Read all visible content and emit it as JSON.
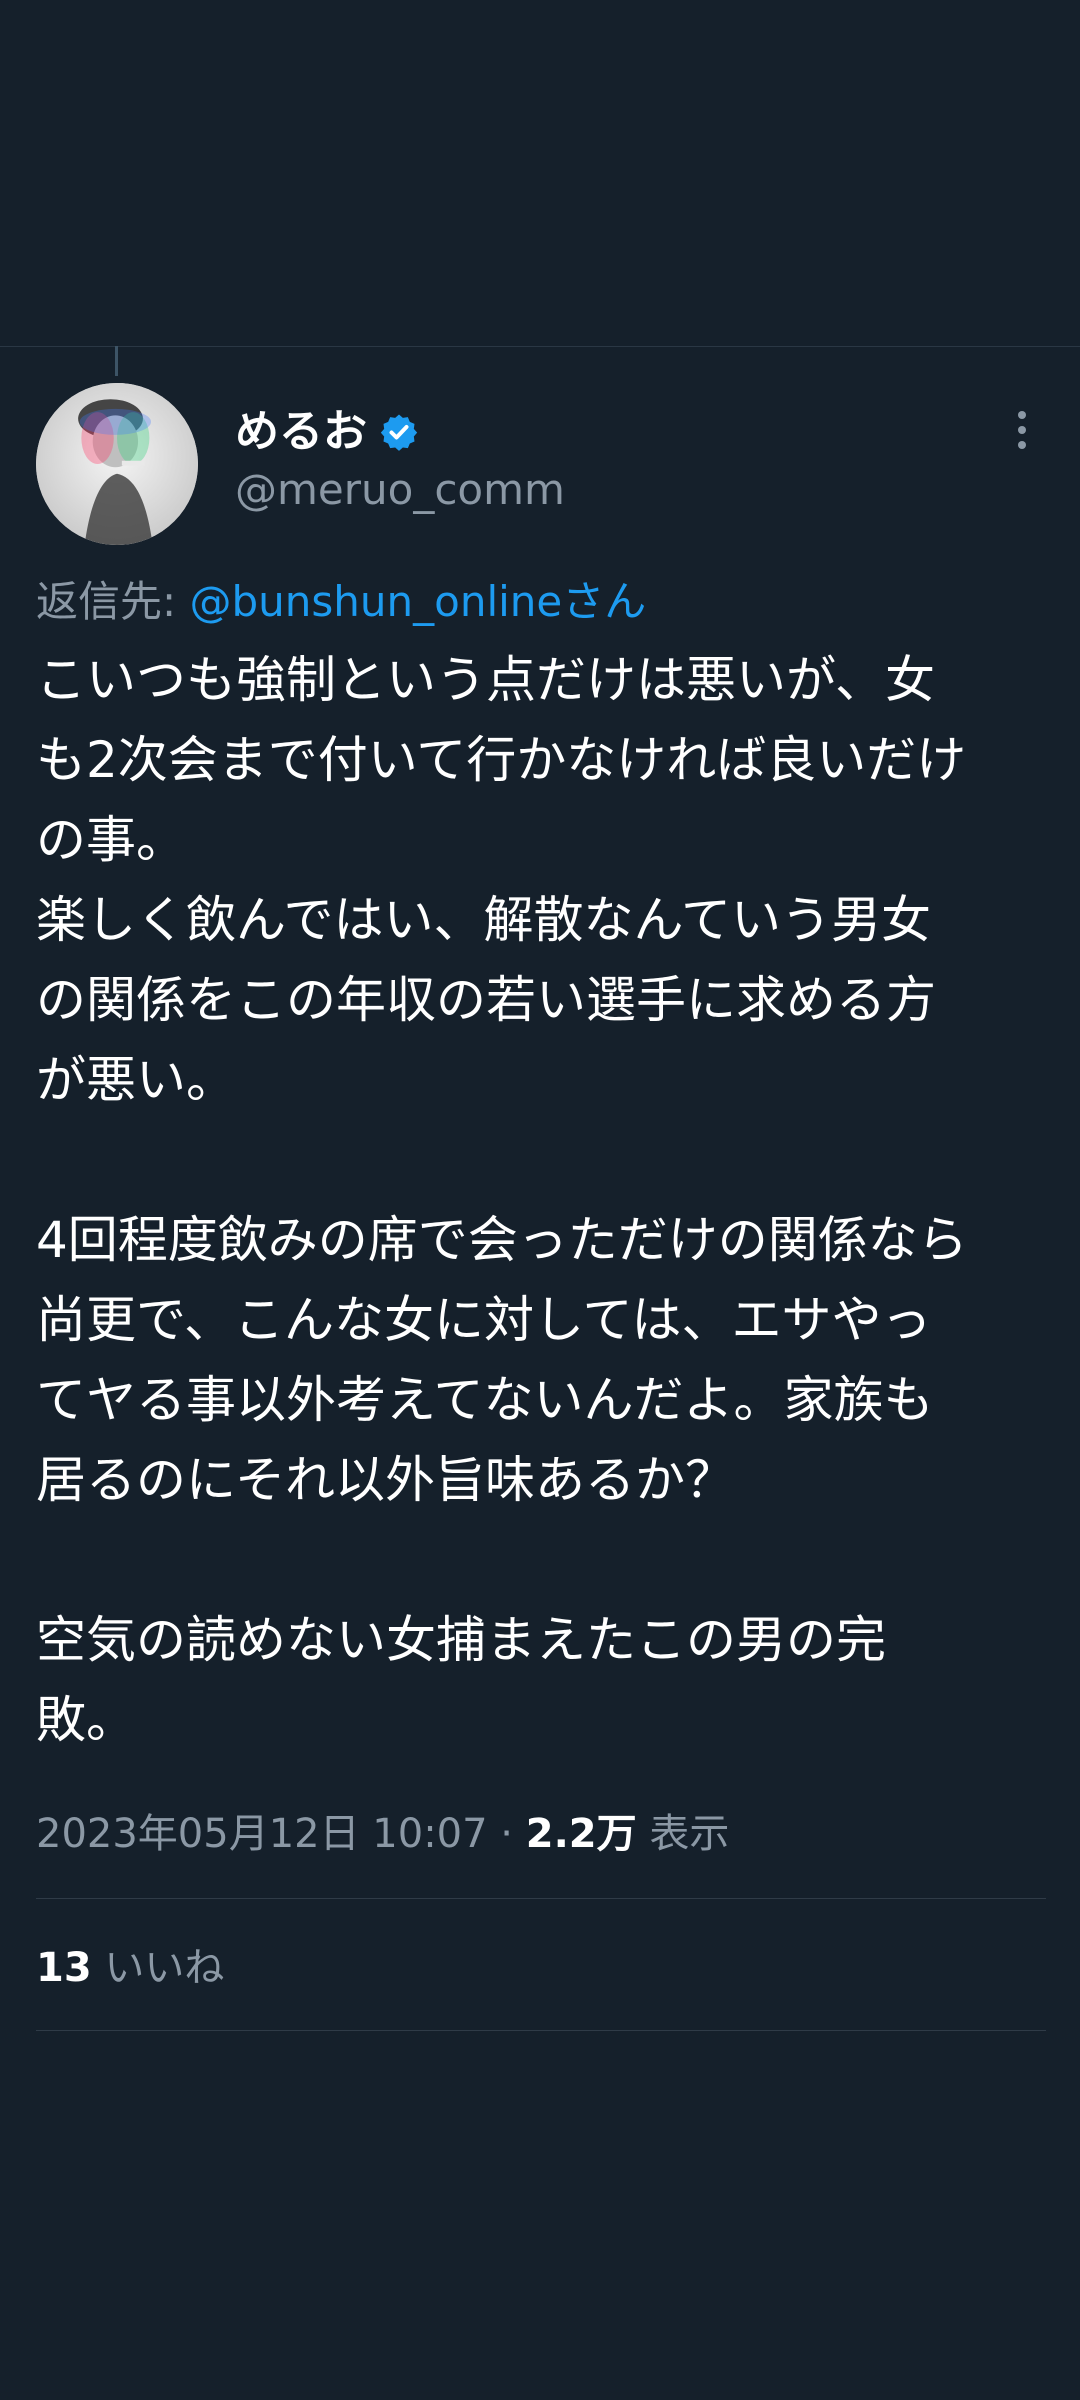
{
  "colors": {
    "background": "#15202b",
    "text_primary": "#ffffff",
    "text_secondary": "#8b98a5",
    "accent": "#1d9bf0",
    "divider": "#2f3b47"
  },
  "author": {
    "display_name": "めるお",
    "handle": "@meruo_comm",
    "verified_icon": "verified-badge-icon",
    "avatar_icon": "avatar-photo"
  },
  "reply": {
    "prefix": "返信先: ",
    "mention": "@bunshun_onlineさん"
  },
  "tweet": {
    "lines": [
      "こいつも強制という点だけは悪いが、女",
      "も2次会まで付いて行かなければ良いだけ",
      "の事。",
      "楽しく飲んではい、解散なんていう男女",
      "の関係をこの年収の若い選手に求める方",
      "が悪い。",
      "",
      "4回程度飲みの席で会っただけの関係なら",
      "尚更で、こんな女に対しては、エサやっ",
      "てヤる事以外考えてないんだよ。家族も",
      "居るのにそれ以外旨味あるか？",
      "",
      "空気の読めない女捕まえたこの男の完",
      "敗。"
    ]
  },
  "meta": {
    "datetime": "2023年05月12日 10:07",
    "separator": " · ",
    "views_count": "2.2万",
    "views_label": " 表示"
  },
  "stats": {
    "likes_count": "13",
    "likes_label": " いいね"
  },
  "menu": {
    "more_icon": "more-vertical-icon"
  }
}
